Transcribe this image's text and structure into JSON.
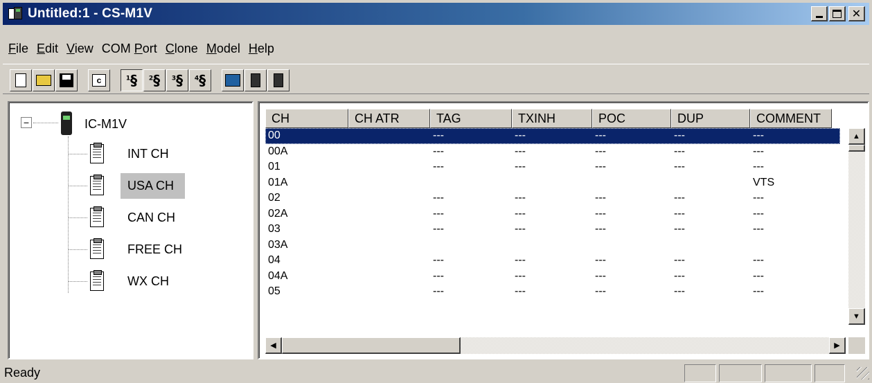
{
  "window": {
    "title": "Untitled:1 - CS-M1V",
    "controls": [
      "minimize",
      "maximize",
      "close"
    ]
  },
  "menu": [
    {
      "label": "File",
      "mnemonic": "F"
    },
    {
      "label": "Edit",
      "mnemonic": "E"
    },
    {
      "label": "View",
      "mnemonic": "V"
    },
    {
      "label": "COM Port",
      "mnemonic": "P"
    },
    {
      "label": "Clone",
      "mnemonic": "C"
    },
    {
      "label": "Model",
      "mnemonic": "M"
    },
    {
      "label": "Help",
      "mnemonic": "H"
    }
  ],
  "toolbar": {
    "buttons": [
      "new-icon",
      "open-folder-icon",
      "save-disk-icon",
      "comment-c-icon",
      "clone-port-1-icon",
      "clone-port-2-icon",
      "clone-port-3-icon",
      "clone-port-4-icon",
      "read-from-radio-icon",
      "write-to-radio-icon",
      "radio-transfer-icon"
    ],
    "c_label": "c",
    "port_digits": [
      "1",
      "2",
      "3",
      "4"
    ]
  },
  "tree": {
    "root": "IC-M1V",
    "expander": "−",
    "items": [
      {
        "label": "INT CH",
        "selected": false
      },
      {
        "label": "USA CH",
        "selected": true
      },
      {
        "label": "CAN CH",
        "selected": false
      },
      {
        "label": "FREE CH",
        "selected": false
      },
      {
        "label": "WX CH",
        "selected": false
      }
    ]
  },
  "table": {
    "columns": [
      "CH",
      "CH ATR",
      "TAG",
      "TXINH",
      "POC",
      "DUP",
      "COMMENT"
    ],
    "rows": [
      {
        "ch": "00",
        "atr": "",
        "tag": "---",
        "txinh": "---",
        "poc": "---",
        "dup": "---",
        "comment": "---",
        "selected": true
      },
      {
        "ch": "00A",
        "atr": "",
        "tag": "---",
        "txinh": "---",
        "poc": "---",
        "dup": "---",
        "comment": "---",
        "selected": false
      },
      {
        "ch": "01",
        "atr": "",
        "tag": "---",
        "txinh": "---",
        "poc": "---",
        "dup": "---",
        "comment": "---",
        "selected": false
      },
      {
        "ch": "01A",
        "atr": "",
        "tag": "",
        "txinh": "",
        "poc": "",
        "dup": "",
        "comment": "VTS",
        "selected": false
      },
      {
        "ch": "02",
        "atr": "",
        "tag": "---",
        "txinh": "---",
        "poc": "---",
        "dup": "---",
        "comment": "---",
        "selected": false
      },
      {
        "ch": "02A",
        "atr": "",
        "tag": "---",
        "txinh": "---",
        "poc": "---",
        "dup": "---",
        "comment": "---",
        "selected": false
      },
      {
        "ch": "03",
        "atr": "",
        "tag": "---",
        "txinh": "---",
        "poc": "---",
        "dup": "---",
        "comment": "---",
        "selected": false
      },
      {
        "ch": "03A",
        "atr": "",
        "tag": "",
        "txinh": "",
        "poc": "",
        "dup": "",
        "comment": "",
        "selected": false
      },
      {
        "ch": "04",
        "atr": "",
        "tag": "---",
        "txinh": "---",
        "poc": "---",
        "dup": "---",
        "comment": "---",
        "selected": false
      },
      {
        "ch": "04A",
        "atr": "",
        "tag": "---",
        "txinh": "---",
        "poc": "---",
        "dup": "---",
        "comment": "---",
        "selected": false
      },
      {
        "ch": "05",
        "atr": "",
        "tag": "---",
        "txinh": "---",
        "poc": "---",
        "dup": "---",
        "comment": "---",
        "selected": false
      }
    ]
  },
  "scrollbars": {
    "up_arrow": "▲",
    "down_arrow": "▼",
    "left_arrow": "◀",
    "right_arrow": "▶"
  },
  "status": {
    "text": "Ready"
  },
  "colors": {
    "title_active": "#0a246a",
    "selection": "#0a246a",
    "face": "#d4d0c8"
  }
}
